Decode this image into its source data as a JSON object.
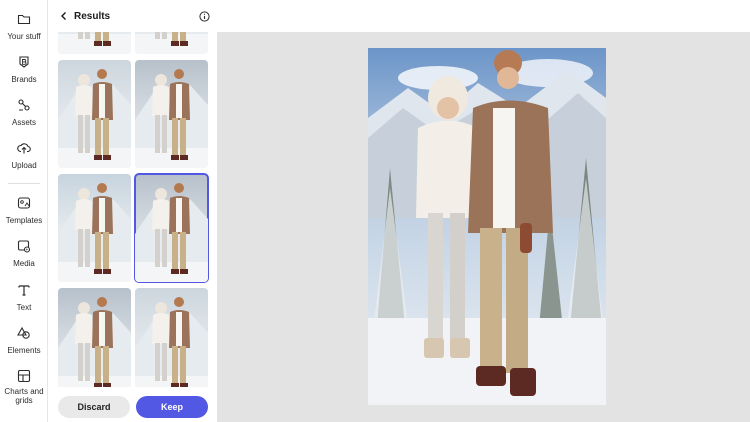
{
  "rail": {
    "items": [
      {
        "label": "Your stuff",
        "icon": "folder-icon"
      },
      {
        "label": "Brands",
        "icon": "brand-icon"
      },
      {
        "label": "Assets",
        "icon": "assets-icon"
      },
      {
        "label": "Upload",
        "icon": "upload-icon"
      },
      {
        "label": "Templates",
        "icon": "templates-icon"
      },
      {
        "label": "Media",
        "icon": "media-icon"
      },
      {
        "label": "Text",
        "icon": "text-icon"
      },
      {
        "label": "Elements",
        "icon": "elements-icon"
      },
      {
        "label": "Charts and grids",
        "icon": "charts-icon"
      }
    ]
  },
  "panel": {
    "title": "Results",
    "selected_index": 3,
    "thumbnail_count": 8
  },
  "footer": {
    "discard_label": "Discard",
    "keep_label": "Keep"
  },
  "colors": {
    "accent": "#5258e4",
    "canvas_bg": "#e3e3e3"
  }
}
